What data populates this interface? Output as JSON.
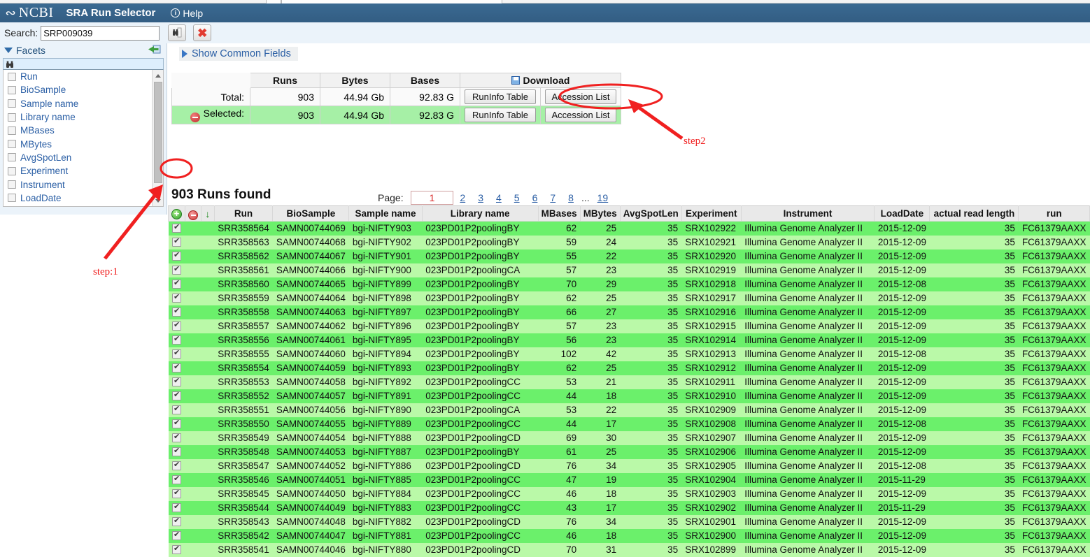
{
  "header": {
    "logo": "NCBI",
    "logo_icon": "dna-icon",
    "title": "SRA Run Selector",
    "help_label": "Help",
    "help_icon": "info-icon"
  },
  "search": {
    "label": "Search:",
    "value": "SRP009039",
    "placeholder": "",
    "search_button_icon": "binoculars-page-icon",
    "clear_button_icon": "red-x-icon"
  },
  "facets": {
    "title": "Facets",
    "caret_icon": "caret-down-icon",
    "collapse_icon": "collapse-panel-icon",
    "filter_icon": "binoculars-icon",
    "filter_value": "",
    "items": [
      {
        "label": "Run"
      },
      {
        "label": "BioSample"
      },
      {
        "label": "Sample name"
      },
      {
        "label": "Library name"
      },
      {
        "label": "MBases"
      },
      {
        "label": "MBytes"
      },
      {
        "label": "AvgSpotLen"
      },
      {
        "label": "Experiment"
      },
      {
        "label": "Instrument"
      },
      {
        "label": "LoadDate"
      }
    ]
  },
  "main": {
    "show_common_fields_label": "Show Common Fields",
    "show_common_fields_icon": "triangle-right-icon"
  },
  "summary": {
    "columns": [
      "",
      "Runs",
      "Bytes",
      "Bases",
      "Download"
    ],
    "download_icon": "floppy-disk-icon",
    "rows": [
      {
        "label": "Total:",
        "runs": "903",
        "bytes": "44.94 Gb",
        "bases": "92.83 G",
        "runinfo_label": "RunInfo Table",
        "accession_label": "Accession List",
        "icon": null
      },
      {
        "label": "Selected:",
        "runs": "903",
        "bytes": "44.94 Gb",
        "bases": "92.83 G",
        "runinfo_label": "RunInfo Table",
        "accession_label": "Accession List",
        "icon": "minus-circle-icon"
      }
    ]
  },
  "results": {
    "found_label": "903 Runs found",
    "pager": {
      "label": "Page:",
      "current": "1",
      "links": [
        "2",
        "3",
        "4",
        "5",
        "6",
        "7",
        "8"
      ],
      "ellipsis": "...",
      "last": "19"
    },
    "select_all_icon": "add-circle-icon",
    "deselect_all_icon": "remove-circle-icon",
    "sort_icon": "arrow-down-icon",
    "columns": [
      "Run",
      "BioSample",
      "Sample name",
      "Library name",
      "MBases",
      "MBytes",
      "AvgSpotLen",
      "Experiment",
      "Instrument",
      "LoadDate",
      "actual read length",
      "run"
    ],
    "rows": [
      {
        "checked": true,
        "run": "SRR358564",
        "biosample": "SAMN00744069",
        "sample_name": "bgi-NIFTY903",
        "library_name": "023PD01P2poolingBY",
        "mbases": "62",
        "mbytes": "25",
        "avgspotlen": "35",
        "experiment": "SRX102922",
        "instrument": "Illumina Genome Analyzer II",
        "loaddate": "2015-12-09",
        "actual_read_length": "35",
        "run2": "FC61379AAXX"
      },
      {
        "checked": true,
        "run": "SRR358563",
        "biosample": "SAMN00744068",
        "sample_name": "bgi-NIFTY902",
        "library_name": "023PD01P2poolingBY",
        "mbases": "59",
        "mbytes": "24",
        "avgspotlen": "35",
        "experiment": "SRX102921",
        "instrument": "Illumina Genome Analyzer II",
        "loaddate": "2015-12-09",
        "actual_read_length": "35",
        "run2": "FC61379AAXX"
      },
      {
        "checked": true,
        "run": "SRR358562",
        "biosample": "SAMN00744067",
        "sample_name": "bgi-NIFTY901",
        "library_name": "023PD01P2poolingBY",
        "mbases": "55",
        "mbytes": "22",
        "avgspotlen": "35",
        "experiment": "SRX102920",
        "instrument": "Illumina Genome Analyzer II",
        "loaddate": "2015-12-09",
        "actual_read_length": "35",
        "run2": "FC61379AAXX"
      },
      {
        "checked": true,
        "run": "SRR358561",
        "biosample": "SAMN00744066",
        "sample_name": "bgi-NIFTY900",
        "library_name": "023PD01P2poolingCA",
        "mbases": "57",
        "mbytes": "23",
        "avgspotlen": "35",
        "experiment": "SRX102919",
        "instrument": "Illumina Genome Analyzer II",
        "loaddate": "2015-12-09",
        "actual_read_length": "35",
        "run2": "FC61379AAXX"
      },
      {
        "checked": true,
        "run": "SRR358560",
        "biosample": "SAMN00744065",
        "sample_name": "bgi-NIFTY899",
        "library_name": "023PD01P2poolingBY",
        "mbases": "70",
        "mbytes": "29",
        "avgspotlen": "35",
        "experiment": "SRX102918",
        "instrument": "Illumina Genome Analyzer II",
        "loaddate": "2015-12-08",
        "actual_read_length": "35",
        "run2": "FC61379AAXX"
      },
      {
        "checked": true,
        "run": "SRR358559",
        "biosample": "SAMN00744064",
        "sample_name": "bgi-NIFTY898",
        "library_name": "023PD01P2poolingBY",
        "mbases": "62",
        "mbytes": "25",
        "avgspotlen": "35",
        "experiment": "SRX102917",
        "instrument": "Illumina Genome Analyzer II",
        "loaddate": "2015-12-09",
        "actual_read_length": "35",
        "run2": "FC61379AAXX"
      },
      {
        "checked": true,
        "run": "SRR358558",
        "biosample": "SAMN00744063",
        "sample_name": "bgi-NIFTY897",
        "library_name": "023PD01P2poolingBY",
        "mbases": "66",
        "mbytes": "27",
        "avgspotlen": "35",
        "experiment": "SRX102916",
        "instrument": "Illumina Genome Analyzer II",
        "loaddate": "2015-12-09",
        "actual_read_length": "35",
        "run2": "FC61379AAXX"
      },
      {
        "checked": true,
        "run": "SRR358557",
        "biosample": "SAMN00744062",
        "sample_name": "bgi-NIFTY896",
        "library_name": "023PD01P2poolingBY",
        "mbases": "57",
        "mbytes": "23",
        "avgspotlen": "35",
        "experiment": "SRX102915",
        "instrument": "Illumina Genome Analyzer II",
        "loaddate": "2015-12-09",
        "actual_read_length": "35",
        "run2": "FC61379AAXX"
      },
      {
        "checked": true,
        "run": "SRR358556",
        "biosample": "SAMN00744061",
        "sample_name": "bgi-NIFTY895",
        "library_name": "023PD01P2poolingBY",
        "mbases": "56",
        "mbytes": "23",
        "avgspotlen": "35",
        "experiment": "SRX102914",
        "instrument": "Illumina Genome Analyzer II",
        "loaddate": "2015-12-09",
        "actual_read_length": "35",
        "run2": "FC61379AAXX"
      },
      {
        "checked": true,
        "run": "SRR358555",
        "biosample": "SAMN00744060",
        "sample_name": "bgi-NIFTY894",
        "library_name": "023PD01P2poolingBY",
        "mbases": "102",
        "mbytes": "42",
        "avgspotlen": "35",
        "experiment": "SRX102913",
        "instrument": "Illumina Genome Analyzer II",
        "loaddate": "2015-12-08",
        "actual_read_length": "35",
        "run2": "FC61379AAXX"
      },
      {
        "checked": true,
        "run": "SRR358554",
        "biosample": "SAMN00744059",
        "sample_name": "bgi-NIFTY893",
        "library_name": "023PD01P2poolingBY",
        "mbases": "62",
        "mbytes": "25",
        "avgspotlen": "35",
        "experiment": "SRX102912",
        "instrument": "Illumina Genome Analyzer II",
        "loaddate": "2015-12-09",
        "actual_read_length": "35",
        "run2": "FC61379AAXX"
      },
      {
        "checked": true,
        "run": "SRR358553",
        "biosample": "SAMN00744058",
        "sample_name": "bgi-NIFTY892",
        "library_name": "023PD01P2poolingCC",
        "mbases": "53",
        "mbytes": "21",
        "avgspotlen": "35",
        "experiment": "SRX102911",
        "instrument": "Illumina Genome Analyzer II",
        "loaddate": "2015-12-09",
        "actual_read_length": "35",
        "run2": "FC61379AAXX"
      },
      {
        "checked": true,
        "run": "SRR358552",
        "biosample": "SAMN00744057",
        "sample_name": "bgi-NIFTY891",
        "library_name": "023PD01P2poolingCC",
        "mbases": "44",
        "mbytes": "18",
        "avgspotlen": "35",
        "experiment": "SRX102910",
        "instrument": "Illumina Genome Analyzer II",
        "loaddate": "2015-12-09",
        "actual_read_length": "35",
        "run2": "FC61379AAXX"
      },
      {
        "checked": true,
        "run": "SRR358551",
        "biosample": "SAMN00744056",
        "sample_name": "bgi-NIFTY890",
        "library_name": "023PD01P2poolingCA",
        "mbases": "53",
        "mbytes": "22",
        "avgspotlen": "35",
        "experiment": "SRX102909",
        "instrument": "Illumina Genome Analyzer II",
        "loaddate": "2015-12-09",
        "actual_read_length": "35",
        "run2": "FC61379AAXX"
      },
      {
        "checked": true,
        "run": "SRR358550",
        "biosample": "SAMN00744055",
        "sample_name": "bgi-NIFTY889",
        "library_name": "023PD01P2poolingCC",
        "mbases": "44",
        "mbytes": "17",
        "avgspotlen": "35",
        "experiment": "SRX102908",
        "instrument": "Illumina Genome Analyzer II",
        "loaddate": "2015-12-08",
        "actual_read_length": "35",
        "run2": "FC61379AAXX"
      },
      {
        "checked": true,
        "run": "SRR358549",
        "biosample": "SAMN00744054",
        "sample_name": "bgi-NIFTY888",
        "library_name": "023PD01P2poolingCD",
        "mbases": "69",
        "mbytes": "30",
        "avgspotlen": "35",
        "experiment": "SRX102907",
        "instrument": "Illumina Genome Analyzer II",
        "loaddate": "2015-12-09",
        "actual_read_length": "35",
        "run2": "FC61379AAXX"
      },
      {
        "checked": true,
        "run": "SRR358548",
        "biosample": "SAMN00744053",
        "sample_name": "bgi-NIFTY887",
        "library_name": "023PD01P2poolingBY",
        "mbases": "61",
        "mbytes": "25",
        "avgspotlen": "35",
        "experiment": "SRX102906",
        "instrument": "Illumina Genome Analyzer II",
        "loaddate": "2015-12-09",
        "actual_read_length": "35",
        "run2": "FC61379AAXX"
      },
      {
        "checked": true,
        "run": "SRR358547",
        "biosample": "SAMN00744052",
        "sample_name": "bgi-NIFTY886",
        "library_name": "023PD01P2poolingCD",
        "mbases": "76",
        "mbytes": "34",
        "avgspotlen": "35",
        "experiment": "SRX102905",
        "instrument": "Illumina Genome Analyzer II",
        "loaddate": "2015-12-08",
        "actual_read_length": "35",
        "run2": "FC61379AAXX"
      },
      {
        "checked": true,
        "run": "SRR358546",
        "biosample": "SAMN00744051",
        "sample_name": "bgi-NIFTY885",
        "library_name": "023PD01P2poolingCC",
        "mbases": "47",
        "mbytes": "19",
        "avgspotlen": "35",
        "experiment": "SRX102904",
        "instrument": "Illumina Genome Analyzer II",
        "loaddate": "2015-11-29",
        "actual_read_length": "35",
        "run2": "FC61379AAXX"
      },
      {
        "checked": true,
        "run": "SRR358545",
        "biosample": "SAMN00744050",
        "sample_name": "bgi-NIFTY884",
        "library_name": "023PD01P2poolingCC",
        "mbases": "46",
        "mbytes": "18",
        "avgspotlen": "35",
        "experiment": "SRX102903",
        "instrument": "Illumina Genome Analyzer II",
        "loaddate": "2015-12-09",
        "actual_read_length": "35",
        "run2": "FC61379AAXX"
      },
      {
        "checked": true,
        "run": "SRR358544",
        "biosample": "SAMN00744049",
        "sample_name": "bgi-NIFTY883",
        "library_name": "023PD01P2poolingCC",
        "mbases": "43",
        "mbytes": "17",
        "avgspotlen": "35",
        "experiment": "SRX102902",
        "instrument": "Illumina Genome Analyzer II",
        "loaddate": "2015-11-29",
        "actual_read_length": "35",
        "run2": "FC61379AAXX"
      },
      {
        "checked": true,
        "run": "SRR358543",
        "biosample": "SAMN00744048",
        "sample_name": "bgi-NIFTY882",
        "library_name": "023PD01P2poolingCD",
        "mbases": "76",
        "mbytes": "34",
        "avgspotlen": "35",
        "experiment": "SRX102901",
        "instrument": "Illumina Genome Analyzer II",
        "loaddate": "2015-12-09",
        "actual_read_length": "35",
        "run2": "FC61379AAXX"
      },
      {
        "checked": true,
        "run": "SRR358542",
        "biosample": "SAMN00744047",
        "sample_name": "bgi-NIFTY881",
        "library_name": "023PD01P2poolingCC",
        "mbases": "46",
        "mbytes": "18",
        "avgspotlen": "35",
        "experiment": "SRX102900",
        "instrument": "Illumina Genome Analyzer II",
        "loaddate": "2015-12-09",
        "actual_read_length": "35",
        "run2": "FC61379AAXX"
      },
      {
        "checked": true,
        "run": "SRR358541",
        "biosample": "SAMN00744046",
        "sample_name": "bgi-NIFTY880",
        "library_name": "023PD01P2poolingCD",
        "mbases": "70",
        "mbytes": "31",
        "avgspotlen": "35",
        "experiment": "SRX102899",
        "instrument": "Illumina Genome Analyzer II",
        "loaddate": "2015-12-09",
        "actual_read_length": "35",
        "run2": "FC61379AAXX"
      }
    ]
  },
  "annotations": {
    "color": "#f02020",
    "step1_label": "step:1",
    "step2_label": "step2"
  }
}
